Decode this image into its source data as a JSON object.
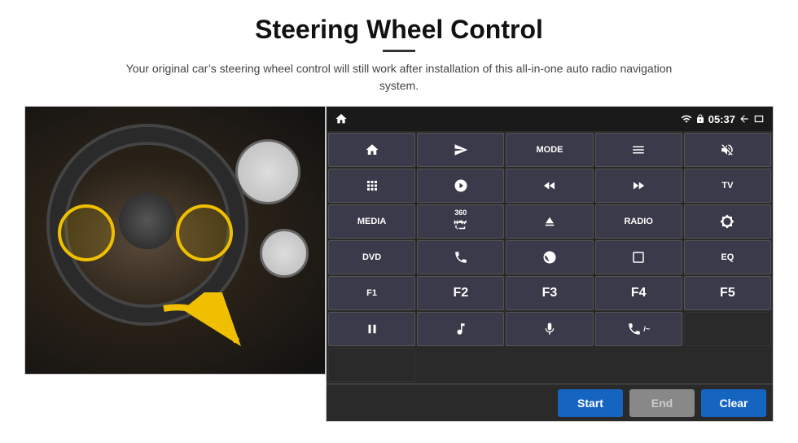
{
  "header": {
    "title": "Steering Wheel Control",
    "subtitle": "Your original car’s steering wheel control will still work after installation of this all-in-one auto radio navigation system."
  },
  "status_bar": {
    "time": "05:37",
    "icons": [
      "wifi",
      "lock",
      "sim",
      "bluetooth"
    ]
  },
  "control_buttons": [
    {
      "id": "r1c1",
      "type": "icon",
      "icon": "home",
      "label": ""
    },
    {
      "id": "r1c2",
      "type": "icon",
      "icon": "send",
      "label": ""
    },
    {
      "id": "r1c3",
      "type": "text",
      "label": "MODE"
    },
    {
      "id": "r1c4",
      "type": "icon",
      "icon": "list",
      "label": ""
    },
    {
      "id": "r1c5",
      "type": "icon",
      "icon": "mute",
      "label": ""
    },
    {
      "id": "r1c6",
      "type": "icon",
      "icon": "dots",
      "label": ""
    },
    {
      "id": "r2c1",
      "type": "icon",
      "icon": "settings-circle",
      "label": ""
    },
    {
      "id": "r2c2",
      "type": "icon",
      "icon": "rewind",
      "label": ""
    },
    {
      "id": "r2c3",
      "type": "icon",
      "icon": "fast-forward",
      "label": ""
    },
    {
      "id": "r2c4",
      "type": "text",
      "label": "TV"
    },
    {
      "id": "r2c5",
      "type": "text",
      "label": "MEDIA"
    },
    {
      "id": "r3c1",
      "type": "text",
      "label": "360"
    },
    {
      "id": "r3c2",
      "type": "icon",
      "icon": "eject",
      "label": ""
    },
    {
      "id": "r3c3",
      "type": "text",
      "label": "RADIO"
    },
    {
      "id": "r3c4",
      "type": "icon",
      "icon": "brightness",
      "label": ""
    },
    {
      "id": "r3c5",
      "type": "text",
      "label": "DVD"
    },
    {
      "id": "r4c1",
      "type": "icon",
      "icon": "phone",
      "label": ""
    },
    {
      "id": "r4c2",
      "type": "icon",
      "icon": "swirl",
      "label": ""
    },
    {
      "id": "r4c3",
      "type": "icon",
      "icon": "rectangle",
      "label": ""
    },
    {
      "id": "r4c4",
      "type": "text",
      "label": "EQ"
    },
    {
      "id": "r4c5",
      "type": "text",
      "label": "F1"
    },
    {
      "id": "r5c1",
      "type": "text",
      "label": "F2"
    },
    {
      "id": "r5c2",
      "type": "text",
      "label": "F3"
    },
    {
      "id": "r5c3",
      "type": "text",
      "label": "F4"
    },
    {
      "id": "r5c4",
      "type": "text",
      "label": "F5"
    },
    {
      "id": "r5c5",
      "type": "icon",
      "icon": "play-pause",
      "label": ""
    },
    {
      "id": "r6c1",
      "type": "icon",
      "icon": "music",
      "label": ""
    },
    {
      "id": "r6c2",
      "type": "icon",
      "icon": "mic",
      "label": ""
    },
    {
      "id": "r6c3",
      "type": "icon",
      "icon": "phone-volume",
      "label": ""
    },
    {
      "id": "r6c4",
      "type": "empty",
      "label": ""
    },
    {
      "id": "r6c5",
      "type": "empty",
      "label": ""
    }
  ],
  "action_buttons": {
    "start": "Start",
    "end": "End",
    "clear": "Clear"
  }
}
